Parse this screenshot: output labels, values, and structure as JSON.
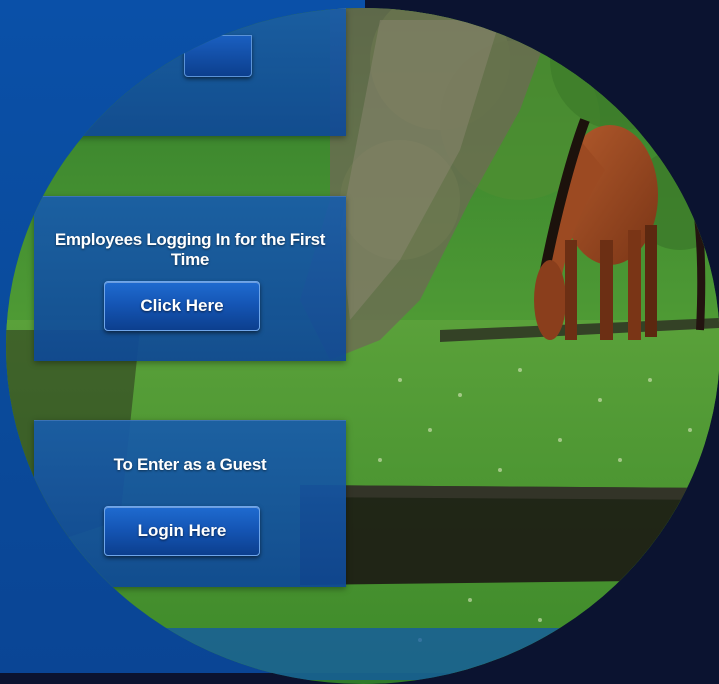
{
  "panels": {
    "first_time": {
      "title": "Employees Logging In for the First Time",
      "button_label": "Click Here"
    },
    "guest": {
      "title": "To Enter as a Guest",
      "button_label": "Login Here"
    }
  },
  "colors": {
    "background_blue": "#0a50a8",
    "background_dark": "#0b1330",
    "panel_blue": "#185caa",
    "button_blue": "#1556b6"
  },
  "image": {
    "subject": "horse-grazing-in-pasture"
  }
}
